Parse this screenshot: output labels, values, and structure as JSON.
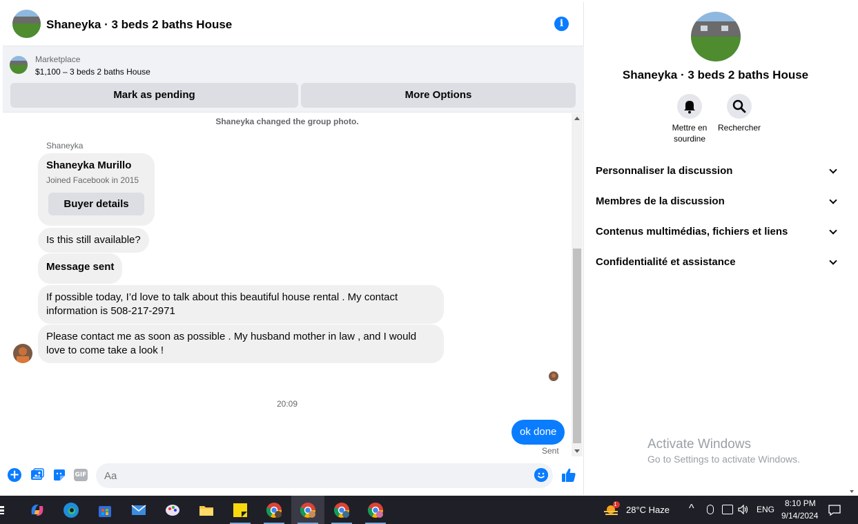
{
  "header": {
    "title": "Shaneyka · 3 beds 2 baths House",
    "info_icon": "info-icon"
  },
  "marketplace": {
    "label": "Marketplace",
    "listing": "$1,100 – 3 beds 2 baths House",
    "buttons": {
      "pending": "Mark as pending",
      "more": "More Options"
    }
  },
  "conversation": {
    "system_message": "Shaneyka changed the group photo.",
    "sender_name": "Shaneyka",
    "card": {
      "name": "Shaneyka Murillo",
      "subtitle": "Joined Facebook in 2015",
      "button": "Buyer details"
    },
    "messages": [
      "Is this still available?",
      "Message sent",
      "If possible today, I’d love to talk about this beautiful house rental . My contact information is 508-217-2971",
      "Please contact me as soon as possible . My husband  mother in law , and I would love to come take a look !"
    ],
    "timestamp": "20:09",
    "outgoing": {
      "text": "ok done",
      "status": "Sent"
    }
  },
  "composer": {
    "placeholder": "Aa"
  },
  "info_panel": {
    "title": "Shaneyka · 3 beds 2 baths House",
    "actions": [
      {
        "label": "Mettre en sourdine",
        "icon": "bell-icon"
      },
      {
        "label": "Rechercher",
        "icon": "search-icon"
      }
    ],
    "sections": [
      "Personnaliser la discussion",
      "Membres de la discussion",
      "Contenus multimédias, fichiers et liens",
      "Confidentialité et assistance"
    ]
  },
  "watermark": {
    "title": "Activate Windows",
    "subtitle": "Go to Settings to activate Windows."
  },
  "taskbar": {
    "weather": "28°C  Haze",
    "weather_badge": "1",
    "language": "ENG",
    "time": "8:10 PM",
    "date": "9/14/2024"
  },
  "colors": {
    "accent": "#0a7cff",
    "bubble": "#f0f0f0",
    "taskbar": "#1f1f28"
  }
}
